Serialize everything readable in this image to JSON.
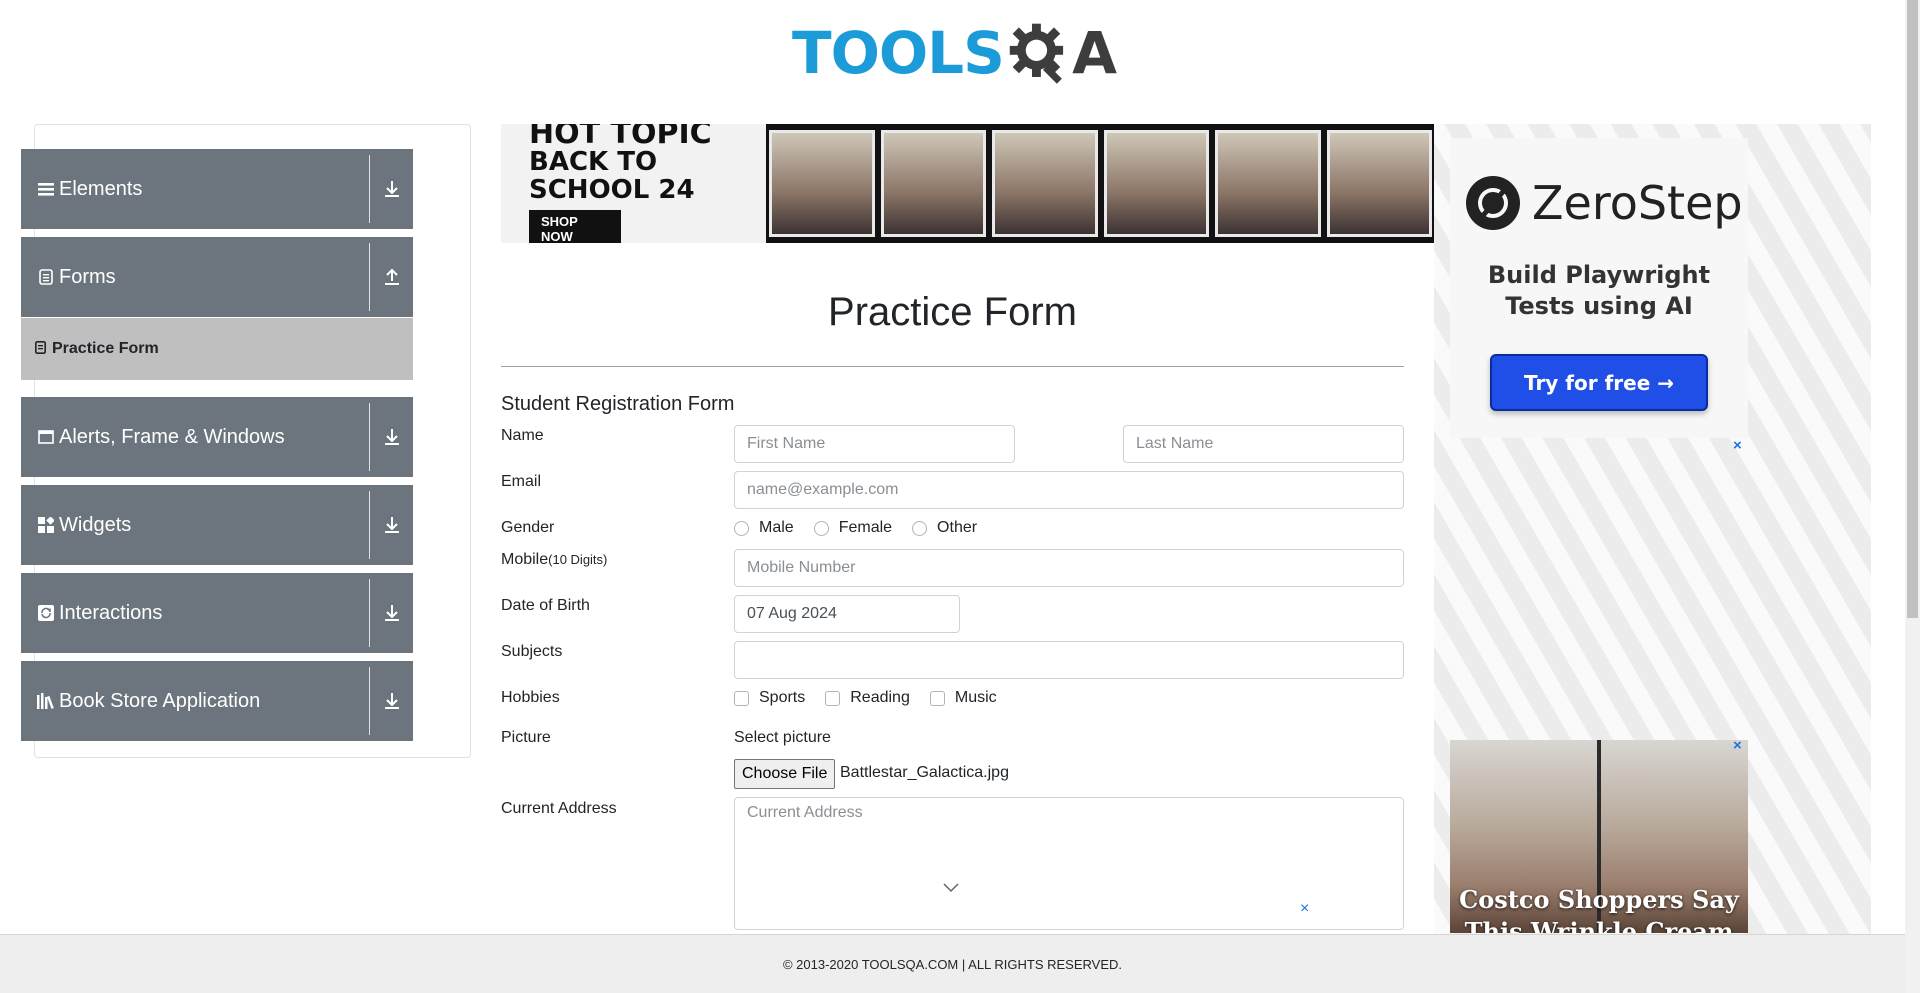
{
  "header": {
    "logo_text": "TOOLS",
    "logo_qa": "A"
  },
  "sidebar": {
    "groups": [
      {
        "label": "Elements",
        "icon": "hamburger-icon",
        "arrow": "download-arrow-icon"
      },
      {
        "label": "Forms",
        "icon": "document-icon",
        "arrow": "upload-arrow-icon"
      },
      {
        "label": "Alerts, Frame & Windows",
        "icon": "window-icon",
        "arrow": "download-arrow-icon"
      },
      {
        "label": "Widgets",
        "icon": "widgets-icon",
        "arrow": "download-arrow-icon"
      },
      {
        "label": "Interactions",
        "icon": "refresh-icon",
        "arrow": "download-arrow-icon"
      },
      {
        "label": "Book Store Application",
        "icon": "books-icon",
        "arrow": "download-arrow-icon"
      }
    ],
    "active_item": {
      "label": "Practice Form",
      "icon": "form-icon"
    }
  },
  "banner_ad": {
    "line1": "HOT TOPIC",
    "line2": "BACK TO SCHOOL 24",
    "cta": "SHOP NOW"
  },
  "form": {
    "page_title": "Practice Form",
    "section_title": "Student Registration Form",
    "name_label": "Name",
    "first_name_placeholder": "First Name",
    "last_name_placeholder": "Last Name",
    "email_label": "Email",
    "email_placeholder": "name@example.com",
    "gender_label": "Gender",
    "gender_options": [
      "Male",
      "Female",
      "Other"
    ],
    "mobile_label": "Mobile",
    "mobile_hint": "(10 Digits)",
    "mobile_placeholder": "Mobile Number",
    "dob_label": "Date of Birth",
    "dob_value": "07 Aug 2024",
    "subjects_label": "Subjects",
    "hobbies_label": "Hobbies",
    "hobby_options": [
      "Sports",
      "Reading",
      "Music"
    ],
    "picture_label": "Picture",
    "select_picture_label": "Select picture",
    "choose_file_label": "Choose File",
    "file_name": "Battlestar_Galactica.jpg",
    "address_label": "Current Address",
    "address_placeholder": "Current Address"
  },
  "right_ads": {
    "zerostep_name": "ZeroStep",
    "zerostep_tagline": "Build Playwright Tests using AI",
    "zerostep_cta": "Try for free →",
    "costco_text": "Costco Shoppers Say This Wrinkle Cream is",
    "close_glyph": "×"
  },
  "footer": {
    "text": "© 2013-2020 TOOLSQA.COM | ALL RIGHTS RESERVED."
  },
  "colors": {
    "sidebar_group_bg": "#6c757d",
    "active_item_bg": "#bfbfbf",
    "logo_blue": "#1b9cd8",
    "cta_blue": "#1f4fe6"
  }
}
